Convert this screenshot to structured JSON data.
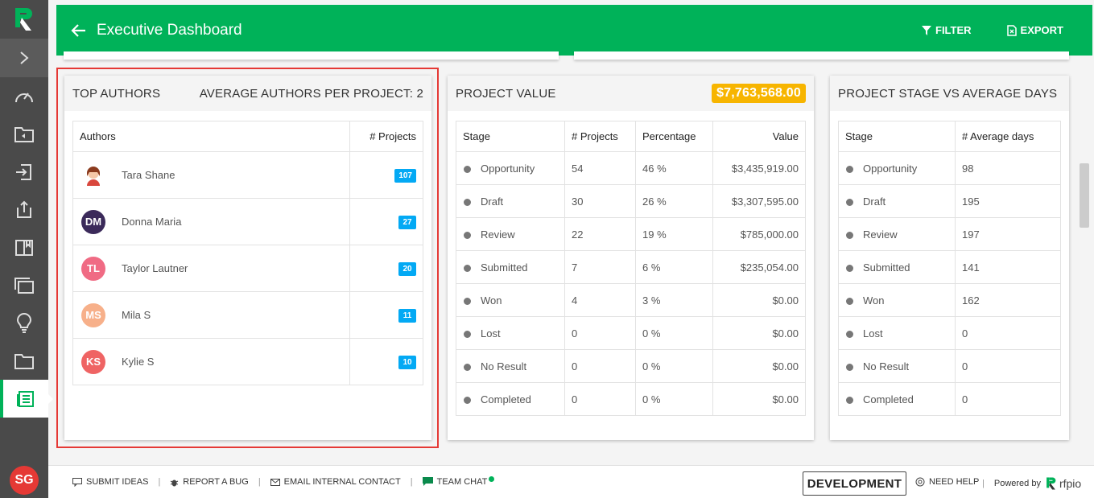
{
  "header": {
    "title": "Executive Dashboard",
    "filter_label": "FILTER",
    "export_label": "EXPORT"
  },
  "sidebar": {
    "user_initials": "SG"
  },
  "top_authors": {
    "title": "TOP AUTHORS",
    "average_label": "AVERAGE AUTHORS PER PROJECT: 2",
    "columns": [
      "Authors",
      "# Projects"
    ],
    "rows": [
      {
        "name": "Tara Shane",
        "initials": "",
        "color": "#ffffff",
        "projects": "107"
      },
      {
        "name": "Donna Maria",
        "initials": "DM",
        "color": "#3b2a5a",
        "projects": "27"
      },
      {
        "name": "Taylor Lautner",
        "initials": "TL",
        "color": "#f06b84",
        "projects": "20"
      },
      {
        "name": "Mila S",
        "initials": "MS",
        "color": "#f7b08a",
        "projects": "11"
      },
      {
        "name": "Kylie S",
        "initials": "KS",
        "color": "#ef6464",
        "projects": "10"
      }
    ]
  },
  "project_value": {
    "title": "PROJECT VALUE",
    "total": "$7,763,568.00",
    "columns": [
      "Stage",
      "# Projects",
      "Percentage",
      "Value"
    ],
    "rows": [
      {
        "stage": "Opportunity",
        "projects": "54",
        "percentage": "46 %",
        "value": "$3,435,919.00"
      },
      {
        "stage": "Draft",
        "projects": "30",
        "percentage": "26 %",
        "value": "$3,307,595.00"
      },
      {
        "stage": "Review",
        "projects": "22",
        "percentage": "19 %",
        "value": "$785,000.00"
      },
      {
        "stage": "Submitted",
        "projects": "7",
        "percentage": "6 %",
        "value": "$235,054.00"
      },
      {
        "stage": "Won",
        "projects": "4",
        "percentage": "3 %",
        "value": "$0.00"
      },
      {
        "stage": "Lost",
        "projects": "0",
        "percentage": "0 %",
        "value": "$0.00"
      },
      {
        "stage": "No Result",
        "projects": "0",
        "percentage": "0 %",
        "value": "$0.00"
      },
      {
        "stage": "Completed",
        "projects": "0",
        "percentage": "0 %",
        "value": "$0.00"
      }
    ]
  },
  "stage_days": {
    "title": "PROJECT STAGE VS AVERAGE DAYS",
    "columns": [
      "Stage",
      "# Average days"
    ],
    "rows": [
      {
        "stage": "Opportunity",
        "days": "98"
      },
      {
        "stage": "Draft",
        "days": "195"
      },
      {
        "stage": "Review",
        "days": "197"
      },
      {
        "stage": "Submitted",
        "days": "141"
      },
      {
        "stage": "Won",
        "days": "162"
      },
      {
        "stage": "Lost",
        "days": "0"
      },
      {
        "stage": "No Result",
        "days": "0"
      },
      {
        "stage": "Completed",
        "days": "0"
      }
    ]
  },
  "footer": {
    "submit_ideas": "SUBMIT IDEAS",
    "report_bug": "REPORT A BUG",
    "email_contact": "EMAIL INTERNAL CONTACT",
    "team_chat": "TEAM CHAT",
    "environment": "DEVELOPMENT",
    "need_help": "NEED HELP",
    "powered_by": "Powered by",
    "brand": "rfpio"
  },
  "colors": {
    "brand_green": "#00b259",
    "badge_blue": "#03a9f4",
    "value_badge": "#f7b500",
    "highlight_red": "#e53935"
  }
}
